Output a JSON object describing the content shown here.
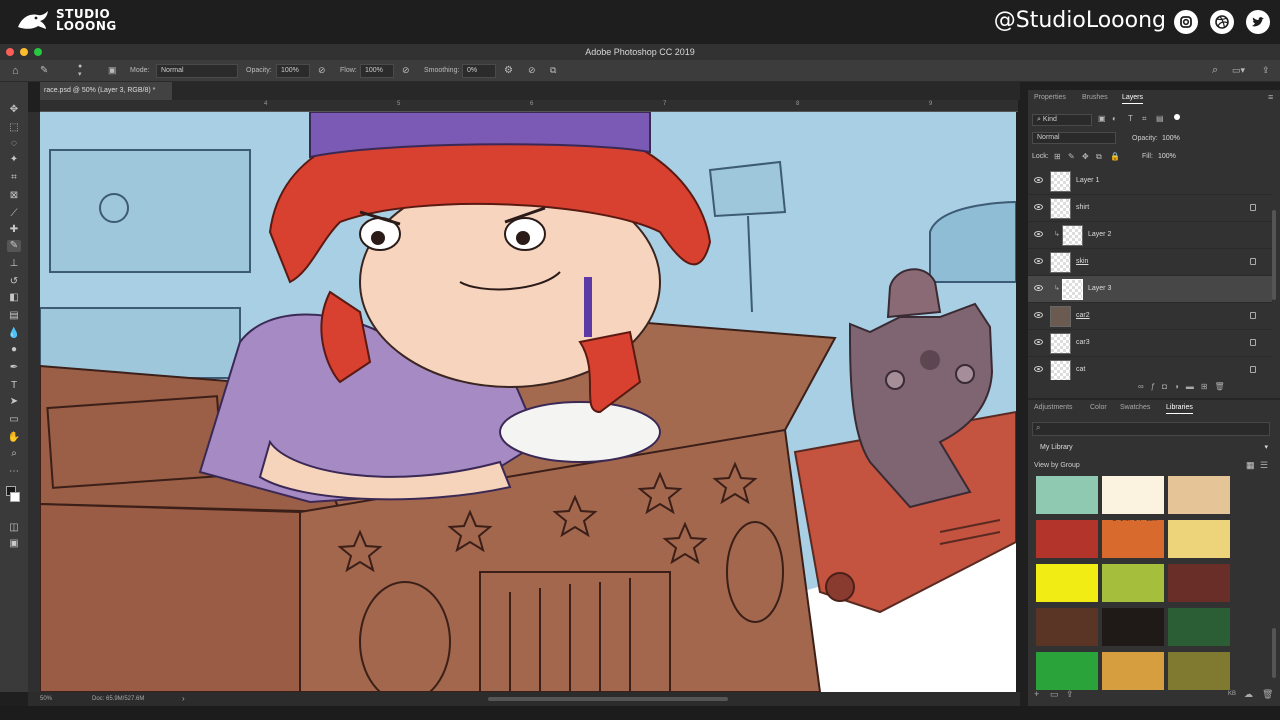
{
  "banner": {
    "brand": "STUDIO LOOONG",
    "brand_line1": "STUDIO",
    "brand_line2": "LOOONG",
    "handle": "@StudioLooong",
    "social_icons": [
      "instagram-icon",
      "dribbble-icon",
      "twitter-icon"
    ]
  },
  "app": {
    "title": "Adobe Photoshop CC 2019"
  },
  "options": {
    "mode_label": "Mode:",
    "mode_value": "Normal",
    "opacity_label": "Opacity:",
    "opacity_value": "100%",
    "flow_label": "Flow:",
    "flow_value": "100%",
    "smoothing_label": "Smoothing:",
    "smoothing_value": "0%"
  },
  "document": {
    "tab": "race.psd @ 50% (Layer 3, RGB/8) *",
    "ruler_marks": [
      "4",
      "5",
      "6",
      "7",
      "8",
      "9"
    ]
  },
  "status": {
    "zoom": "50%",
    "doc": "Doc: 65.9M/527.6M"
  },
  "layers_panel": {
    "tabs": [
      "Properties",
      "Brushes",
      "Layers"
    ],
    "active_tab": "Layers",
    "filter": "Kind",
    "blend_mode": "Normal",
    "opacity_label": "Opacity:",
    "opacity_value": "100%",
    "lock_label": "Lock:",
    "fill_label": "Fill:",
    "fill_value": "100%",
    "layers": [
      {
        "name": "Layer 1",
        "locked": false,
        "selected": false,
        "clipped": false
      },
      {
        "name": "shirt",
        "locked": true,
        "selected": false,
        "clipped": false
      },
      {
        "name": "Layer 2",
        "locked": false,
        "selected": false,
        "clipped": true
      },
      {
        "name": "skin",
        "locked": true,
        "selected": false,
        "clipped": false
      },
      {
        "name": "Layer 3",
        "locked": false,
        "selected": true,
        "clipped": true
      },
      {
        "name": "car2",
        "locked": true,
        "selected": false,
        "clipped": false
      },
      {
        "name": "car3",
        "locked": true,
        "selected": false,
        "clipped": false
      },
      {
        "name": "cat",
        "locked": true,
        "selected": false,
        "clipped": false
      }
    ]
  },
  "libraries_panel": {
    "tabs": [
      "Adjustments",
      "Color",
      "Swatches",
      "Libraries"
    ],
    "active_tab": "Libraries",
    "library": "My Library",
    "view_by": "View by Group",
    "swatch_tooltip": "C=1 M=1 Y=12...",
    "swatches": [
      "#8fc9b1",
      "#fbf3e0",
      "#e5c597",
      "#b3342b",
      "#d96a2d",
      "#edd37a",
      "#f0ec14",
      "#a5bf3c",
      "#6a2e28",
      "#5a3424",
      "#1f1a17",
      "#2c5e36",
      "#2aa33a",
      "#d79e40",
      "#7f7a30"
    ]
  }
}
